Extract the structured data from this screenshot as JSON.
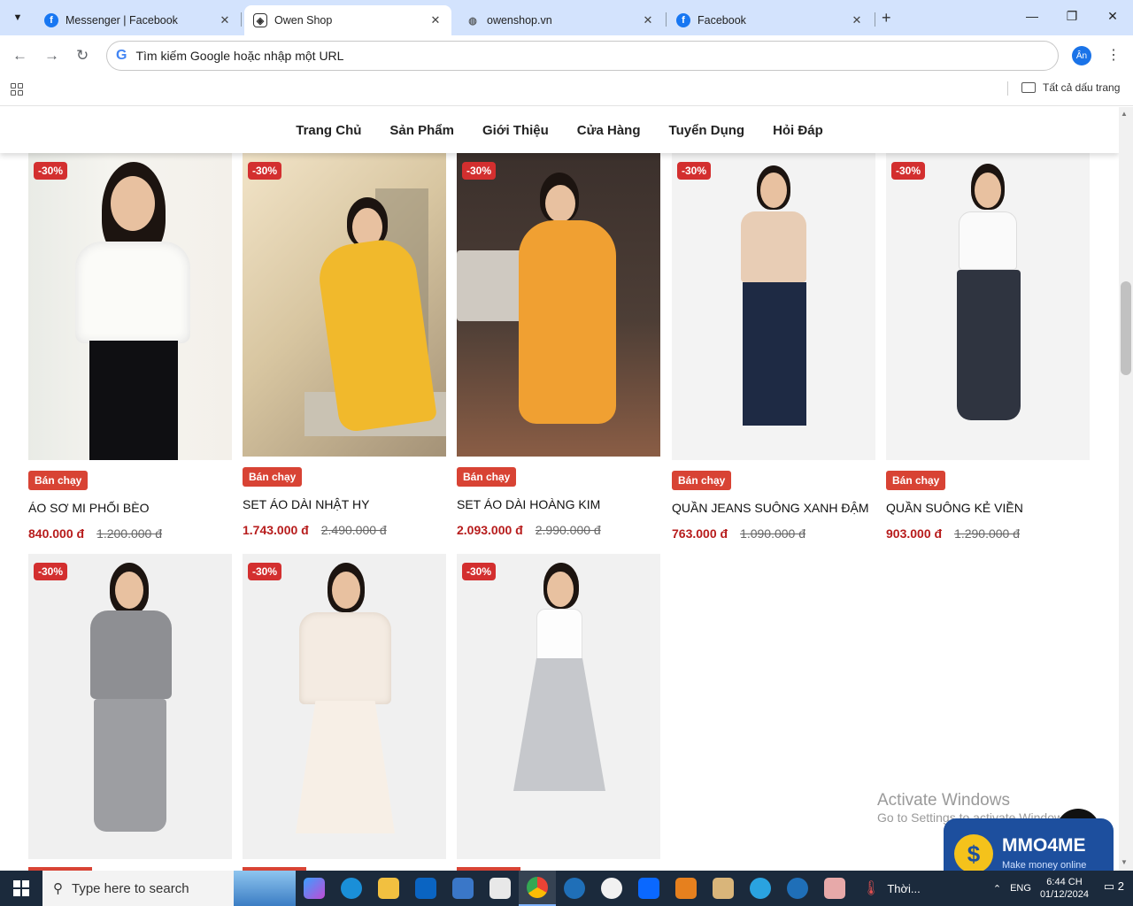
{
  "browser": {
    "tabs": [
      {
        "title": "Messenger | Facebook",
        "icon": "facebook-icon",
        "active": false
      },
      {
        "title": "Owen Shop",
        "icon": "owen-shop-icon",
        "active": true
      },
      {
        "title": "owenshop.vn",
        "icon": "globe-icon",
        "active": false
      },
      {
        "title": "Facebook",
        "icon": "facebook-icon",
        "active": false
      }
    ],
    "new_tab": "+",
    "window_controls": {
      "minimize": "—",
      "restore": "❐",
      "close": "✕"
    },
    "omnibox": {
      "placeholder": "Tìm kiếm Google hoặc nhập một URL",
      "google_glyph": "G"
    },
    "profile_initial": "Ân",
    "bookmarks_all_label": "Tất cả dấu trang"
  },
  "site_nav": {
    "items": [
      "Trang Chủ",
      "Sản Phẩm",
      "Giới Thiệu",
      "Cửa Hàng",
      "Tuyển Dụng",
      "Hỏi Đáp"
    ]
  },
  "products": [
    {
      "discount": "-30%",
      "badge": "Bán chạy",
      "name": "ÁO SƠ MI PHỐI BÈO",
      "price": "840.000 đ",
      "old_price": "1.200.000 đ"
    },
    {
      "discount": "-30%",
      "badge": "Bán chạy",
      "name": "SET ÁO DÀI NHẬT HY",
      "price": "1.743.000 đ",
      "old_price": "2.490.000 đ"
    },
    {
      "discount": "-30%",
      "badge": "Bán chạy",
      "name": "SET ÁO DÀI HOÀNG KIM",
      "price": "2.093.000 đ",
      "old_price": "2.990.000 đ"
    },
    {
      "discount": "-30%",
      "badge": "Bán chạy",
      "name": "QUẦN JEANS SUÔNG XANH ĐẬM",
      "price": "763.000 đ",
      "old_price": "1.090.000 đ"
    },
    {
      "discount": "-30%",
      "badge": "Bán chạy",
      "name": "QUẦN SUÔNG KẺ VIỀN",
      "price": "903.000 đ",
      "old_price": "1.290.000 đ"
    },
    {
      "discount": "-30%"
    },
    {
      "discount": "-30%"
    },
    {
      "discount": "-30%"
    }
  ],
  "overlays": {
    "activate_title": "Activate Windows",
    "activate_sub": "Go to Settings to activate Windows.",
    "watermark_brand": "MMO4ME",
    "watermark_sub": "Make money online",
    "watermark_coin": "$",
    "back_to_top": "︽"
  },
  "taskbar": {
    "search_placeholder": "Type here to search",
    "weather_label": "Thời...",
    "language": "ENG",
    "time": "6:44 CH",
    "date": "01/12/2024",
    "notification_count": "2"
  },
  "colors": {
    "tabstrip_bg": "#d3e3fd",
    "discount_red": "#d32f2f",
    "badge_red": "#d84334",
    "price_red": "#b71c1c",
    "taskbar_bg": "#1b2a3c"
  }
}
